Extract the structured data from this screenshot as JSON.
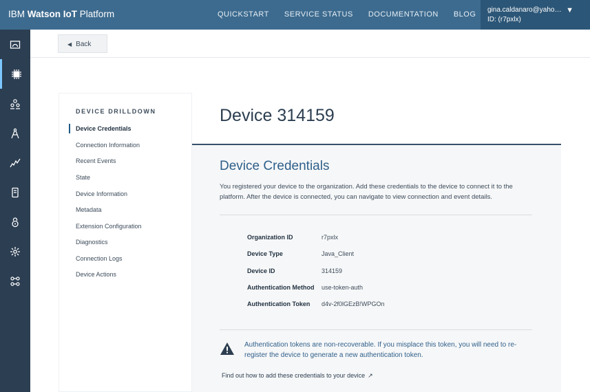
{
  "header": {
    "brand_ibm": "IBM",
    "brand_watson": "Watson IoT",
    "brand_platform": "Platform",
    "nav": [
      "QUICKSTART",
      "SERVICE STATUS",
      "DOCUMENTATION",
      "BLOG"
    ],
    "user_email": "gina.caldanaro@yahoo.com",
    "user_id": "ID: (r7pxlx)"
  },
  "rail_icons": [
    "dashboard-icon",
    "devices-icon",
    "members-icon",
    "rules-icon",
    "analytics-icon",
    "apps-icon",
    "security-icon",
    "settings-icon",
    "extensions-icon"
  ],
  "back_label": "Back",
  "sidenav": {
    "title": "DEVICE DRILLDOWN",
    "items": [
      "Device Credentials",
      "Connection Information",
      "Recent Events",
      "State",
      "Device Information",
      "Metadata",
      "Extension Configuration",
      "Diagnostics",
      "Connection Logs",
      "Device Actions"
    ],
    "active_index": 0
  },
  "main": {
    "title": "Device 314159",
    "section_title": "Device Credentials",
    "section_desc": "You registered your device to the organization. Add these credentials to the device to connect it to the platform. After the device is connected, you can navigate to view connection and event details.",
    "credentials": [
      {
        "label": "Organization ID",
        "value": "r7pxlx"
      },
      {
        "label": "Device Type",
        "value": "Java_Client"
      },
      {
        "label": "Device ID",
        "value": "314159"
      },
      {
        "label": "Authentication Method",
        "value": "use-token-auth"
      },
      {
        "label": "Authentication Token",
        "value": "d4v-2f0lGEzB!WPGOn"
      }
    ],
    "warning": "Authentication tokens are non-recoverable. If you misplace this token, you will need to re-register the device to generate a new authentication token.",
    "learn_link": "Find out how to add these credentials to your device"
  },
  "colors": {
    "topbar": "#3d6b8f",
    "rail": "#2c3e52",
    "accent": "#2e5f8a"
  }
}
